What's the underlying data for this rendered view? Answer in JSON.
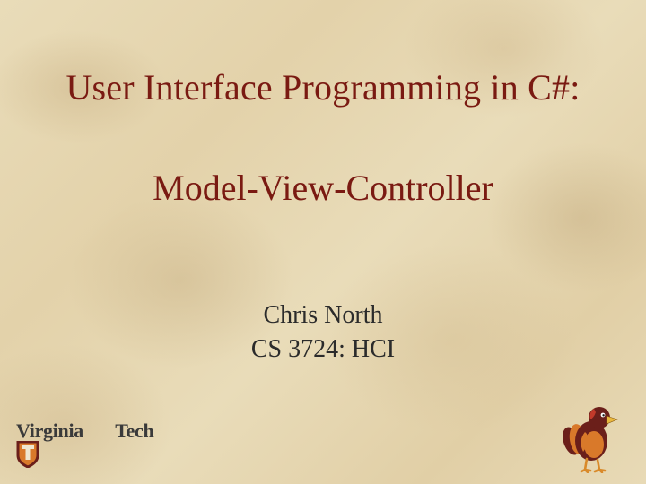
{
  "title": "User Interface Programming in C#:",
  "subtitle": "Model-View-Controller",
  "author": "Chris North",
  "course": "CS 3724:  HCI",
  "logo": {
    "word1": "Virginia",
    "word2": "Tech"
  },
  "colors": {
    "heading": "#7a1a12",
    "body": "#2b2b2b",
    "vt_maroon": "#6b1f1a",
    "vt_orange": "#d9792a"
  }
}
